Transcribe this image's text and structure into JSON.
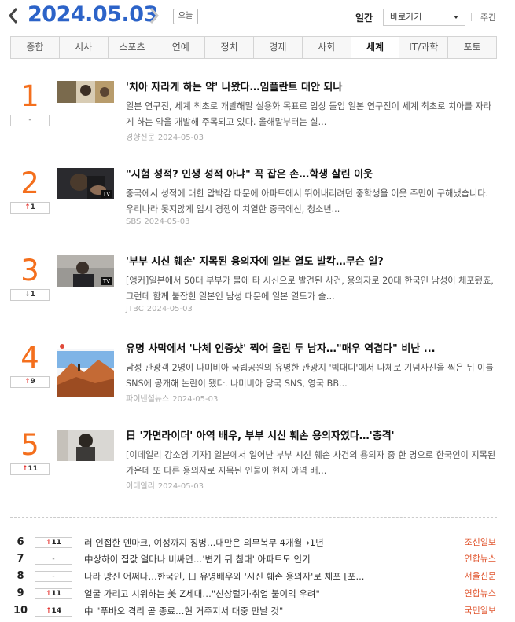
{
  "header": {
    "date": "2024.05.03",
    "today_label": "오늘",
    "period_label": "일간",
    "goto_label": "바로가기",
    "weekly_label": "주간"
  },
  "tabs": [
    {
      "label": "종합"
    },
    {
      "label": "시사"
    },
    {
      "label": "스포츠"
    },
    {
      "label": "연예"
    },
    {
      "label": "정치"
    },
    {
      "label": "경제"
    },
    {
      "label": "사회"
    },
    {
      "label": "세계",
      "active": true
    },
    {
      "label": "IT/과학"
    },
    {
      "label": "포토"
    }
  ],
  "top_items": [
    {
      "rank": "1",
      "change": "-",
      "direction": "flat",
      "title": "'치아 자라게 하는 약' 나왔다…임플란트 대안 되나",
      "desc": "일본 연구진, 세계 최초로 개발해말 실용화 목표로 임상 돌입 일본 연구진이 세계 최초로 치아를 자라게 하는 약을 개발해 주목되고 있다. 올해말부터는 실...",
      "press": "경향신문",
      "date": "2024-05-03",
      "tv": false
    },
    {
      "rank": "2",
      "change": "1",
      "direction": "up",
      "title": "\"시험 성적? 인생 성적 아냐\" 꼭 잡은 손…학생 살린 이웃",
      "desc": "중국에서 성적에 대한 압박감 때문에 아파트에서 뛰어내리려던 중학생을 이웃 주민이 구해냈습니다. 우리나라 못지않게 입시 경쟁이 치열한 중국에선, 청소년...",
      "press": "SBS",
      "date": "2024-05-03",
      "tv": true
    },
    {
      "rank": "3",
      "change": "1",
      "direction": "down",
      "title": "'부부 시신 훼손' 지목된 용의자에 일본 열도 발칵…무슨 일?",
      "desc": "[앵커]일본에서 50대 부부가 불에 타 시신으로 발견된 사건, 용의자로 20대 한국인 남성이 체포됐죠, 그런데 함께 붙잡힌 일본인 남성 때문에 일본 열도가 술...",
      "press": "JTBC",
      "date": "2024-05-03",
      "tv": true
    },
    {
      "rank": "4",
      "change": "9",
      "direction": "up",
      "title": "유명 사막에서 '나체 인증샷' 찍어 올린 두 남자…\"매우 역겹다\" 비난 ...",
      "desc": "남성 관광객 2명이 나미비아 국립공원의 유명한 관광지 '빅대디'에서 나체로 기념사진을 찍은 뒤 이를 SNS에 공개해 논란이 됐다. 나미비아 당국 SNS, 영국 BB...",
      "press": "파이낸셜뉴스",
      "date": "2024-05-03",
      "tv": false
    },
    {
      "rank": "5",
      "change": "11",
      "direction": "up",
      "title": "日 '가면라이더' 아역 배우, 부부 시신 훼손 용의자였다…'충격'",
      "desc": "[이데일리 강소영 기자] 일본에서 일어난 부부 시신 훼손 사건의 용의자 중 한 명으로 한국인이 지목된 가운데 또 다른 용의자로 지목된 인물이 현지 아역 배...",
      "press": "이데일리",
      "date": "2024-05-03",
      "tv": false
    }
  ],
  "list_items": [
    {
      "rank": "6",
      "change": "11",
      "direction": "up",
      "title": "러 인접한 덴마크, 여성까지 징병…대만은 의무복무 4개월→1년",
      "press": "조선일보"
    },
    {
      "rank": "7",
      "change": "-",
      "direction": "flat",
      "title": "中상하이 집값 얼마나 비싸면…'변기 뒤 침대' 아파트도 인기",
      "press": "연합뉴스"
    },
    {
      "rank": "8",
      "change": "-",
      "direction": "flat",
      "title": "나라 망신 어쩌나…한국인, 日 유명배우와 '시신 훼손 용의자'로 체포 [포...",
      "press": "서울신문"
    },
    {
      "rank": "9",
      "change": "11",
      "direction": "up",
      "title": "얼굴 가리고 시위하는 美 Z세대…\"신상털기·취업 불이익 우려\"",
      "press": "연합뉴스"
    },
    {
      "rank": "10",
      "change": "14",
      "direction": "up",
      "title": "中 \"푸바오 격리 곧 종료…현 거주지서 대중 만날 것\"",
      "press": "국민일보"
    }
  ],
  "icons": {
    "prev": "chevron-left-icon",
    "next": "chevron-right-icon",
    "up": "arrow-up-icon",
    "down": "arrow-down-icon",
    "tv": "tv-badge-icon"
  },
  "colors": {
    "date": "#2c63c8",
    "rank": "#f46f1d",
    "up": "#e53935",
    "press_small": "#e0552e"
  }
}
